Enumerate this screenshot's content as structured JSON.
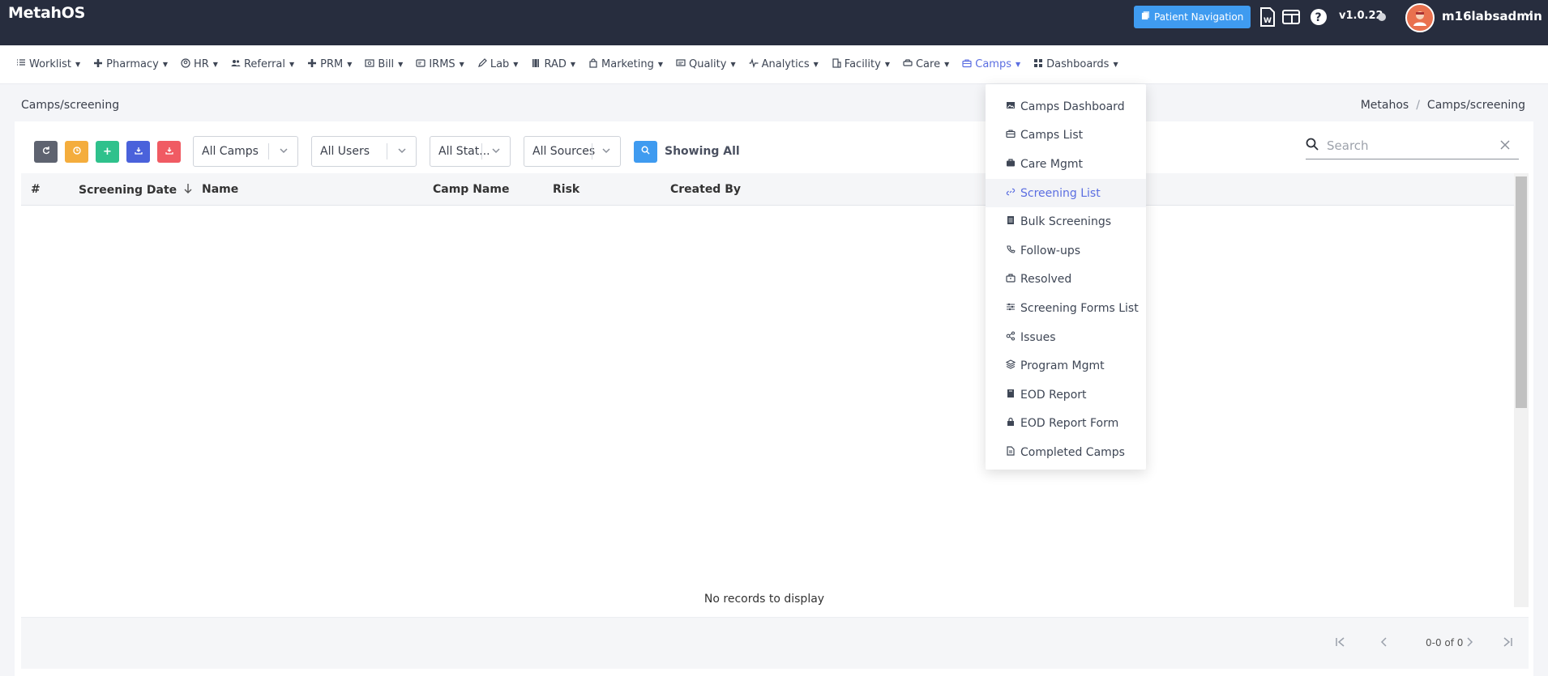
{
  "brand": "MetahOS",
  "header": {
    "patient_nav_label": "Patient Navigation",
    "version": "v1.0.22",
    "username": "m16labsadmin"
  },
  "nav": [
    {
      "label": "Worklist",
      "icon": "list-icon"
    },
    {
      "label": "Pharmacy",
      "icon": "plus-icon"
    },
    {
      "label": "HR",
      "icon": "user-circle-icon"
    },
    {
      "label": "Referral",
      "icon": "users-icon"
    },
    {
      "label": "PRM",
      "icon": "plus-icon"
    },
    {
      "label": "Bill",
      "icon": "bill-icon"
    },
    {
      "label": "IRMS",
      "icon": "id-card-icon"
    },
    {
      "label": "Lab",
      "icon": "pen-icon"
    },
    {
      "label": "RAD",
      "icon": "film-icon"
    },
    {
      "label": "Marketing",
      "icon": "bag-icon"
    },
    {
      "label": "Quality",
      "icon": "tv-icon"
    },
    {
      "label": "Analytics",
      "icon": "pulse-icon"
    },
    {
      "label": "Facility",
      "icon": "building-icon"
    },
    {
      "label": "Care",
      "icon": "car-icon"
    },
    {
      "label": "Camps",
      "icon": "briefcase-icon",
      "active": true
    },
    {
      "label": "Dashboards",
      "icon": "grid-icon"
    }
  ],
  "page": {
    "title": "Camps/screening",
    "breadcrumb": [
      "Metahos",
      "Camps/screening"
    ]
  },
  "filters": {
    "camps": "All Camps",
    "users": "All Users",
    "status": "All Stat...",
    "sources": "All Sources",
    "showing": "Showing All"
  },
  "search": {
    "placeholder": "Search"
  },
  "table": {
    "columns": [
      "#",
      "Screening Date",
      "Name",
      "Camp Name",
      "Risk",
      "Created By"
    ],
    "empty_text": "No records to display"
  },
  "pagination": {
    "info": "0-0 of 0"
  },
  "dropdown": [
    {
      "label": "Camps Dashboard",
      "icon": "image-icon"
    },
    {
      "label": "Camps List",
      "icon": "briefcase-icon"
    },
    {
      "label": "Care Mgmt",
      "icon": "briefcase-filled-icon"
    },
    {
      "label": "Screening List",
      "icon": "link-icon",
      "active": true
    },
    {
      "label": "Bulk Screenings",
      "icon": "document-icon"
    },
    {
      "label": "Follow-ups",
      "icon": "phone-icon"
    },
    {
      "label": "Resolved",
      "icon": "toolbox-icon"
    },
    {
      "label": "Screening Forms List",
      "icon": "sliders-icon"
    },
    {
      "label": "Issues",
      "icon": "share-icon"
    },
    {
      "label": "Program Mgmt",
      "icon": "layers-icon"
    },
    {
      "label": "EOD Report",
      "icon": "book-icon"
    },
    {
      "label": "EOD Report Form",
      "icon": "lock-icon"
    },
    {
      "label": "Completed Camps",
      "icon": "file-icon"
    }
  ],
  "colors": {
    "topbar": "#272d3e",
    "accent": "#5b6ee1",
    "blue_button": "#3f9bf0",
    "gray_button": "#5e6370",
    "orange_button": "#f4ad3d",
    "green_button": "#2fc18c",
    "indigo_button": "#4a62db",
    "red_button": "#f05b63"
  }
}
